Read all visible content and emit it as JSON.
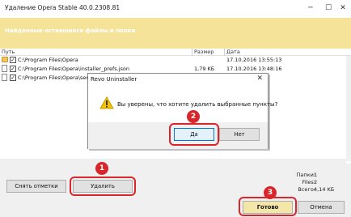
{
  "window": {
    "title": "Удаление Opera Stable 40.0.2308.81"
  },
  "banner": {
    "text": "Найденные оставшиеся файлы и папки"
  },
  "list": {
    "columns": [
      "Путь",
      "Размер",
      "Дата"
    ],
    "rows": [
      {
        "path": "C:\\Program Files\\Opera",
        "size": "",
        "date": "17.10.2016 13:55:13"
      },
      {
        "path": "C:\\Program Files\\Opera\\installer_prefs.json",
        "size": "1,79 KБ",
        "date": "17.10.2016 13:48:16"
      },
      {
        "path": "C:\\Program Files\\Opera\\server",
        "size": "",
        "date": ""
      }
    ]
  },
  "dialog": {
    "title": "Revo Uninstaller",
    "message": "Вы уверены, что хотите удалить выбранные пункты?",
    "yes_label": "Да",
    "no_label": "Нет"
  },
  "footer": {
    "uncheck_label": "Снять отметки",
    "delete_label": "Удалить",
    "finish_label": "Готово",
    "cancel_label": "Отмена",
    "stats": {
      "folders_label": "Папки:",
      "folders_value": "1",
      "files_label": "Files:",
      "files_value": "2",
      "total_label": "Всего:",
      "total_value": "4,14 KБ"
    }
  },
  "badges": {
    "one": "1",
    "two": "2",
    "three": "3"
  },
  "colors": {
    "banner": "#f5e39a",
    "highlight": "#d8262a"
  }
}
